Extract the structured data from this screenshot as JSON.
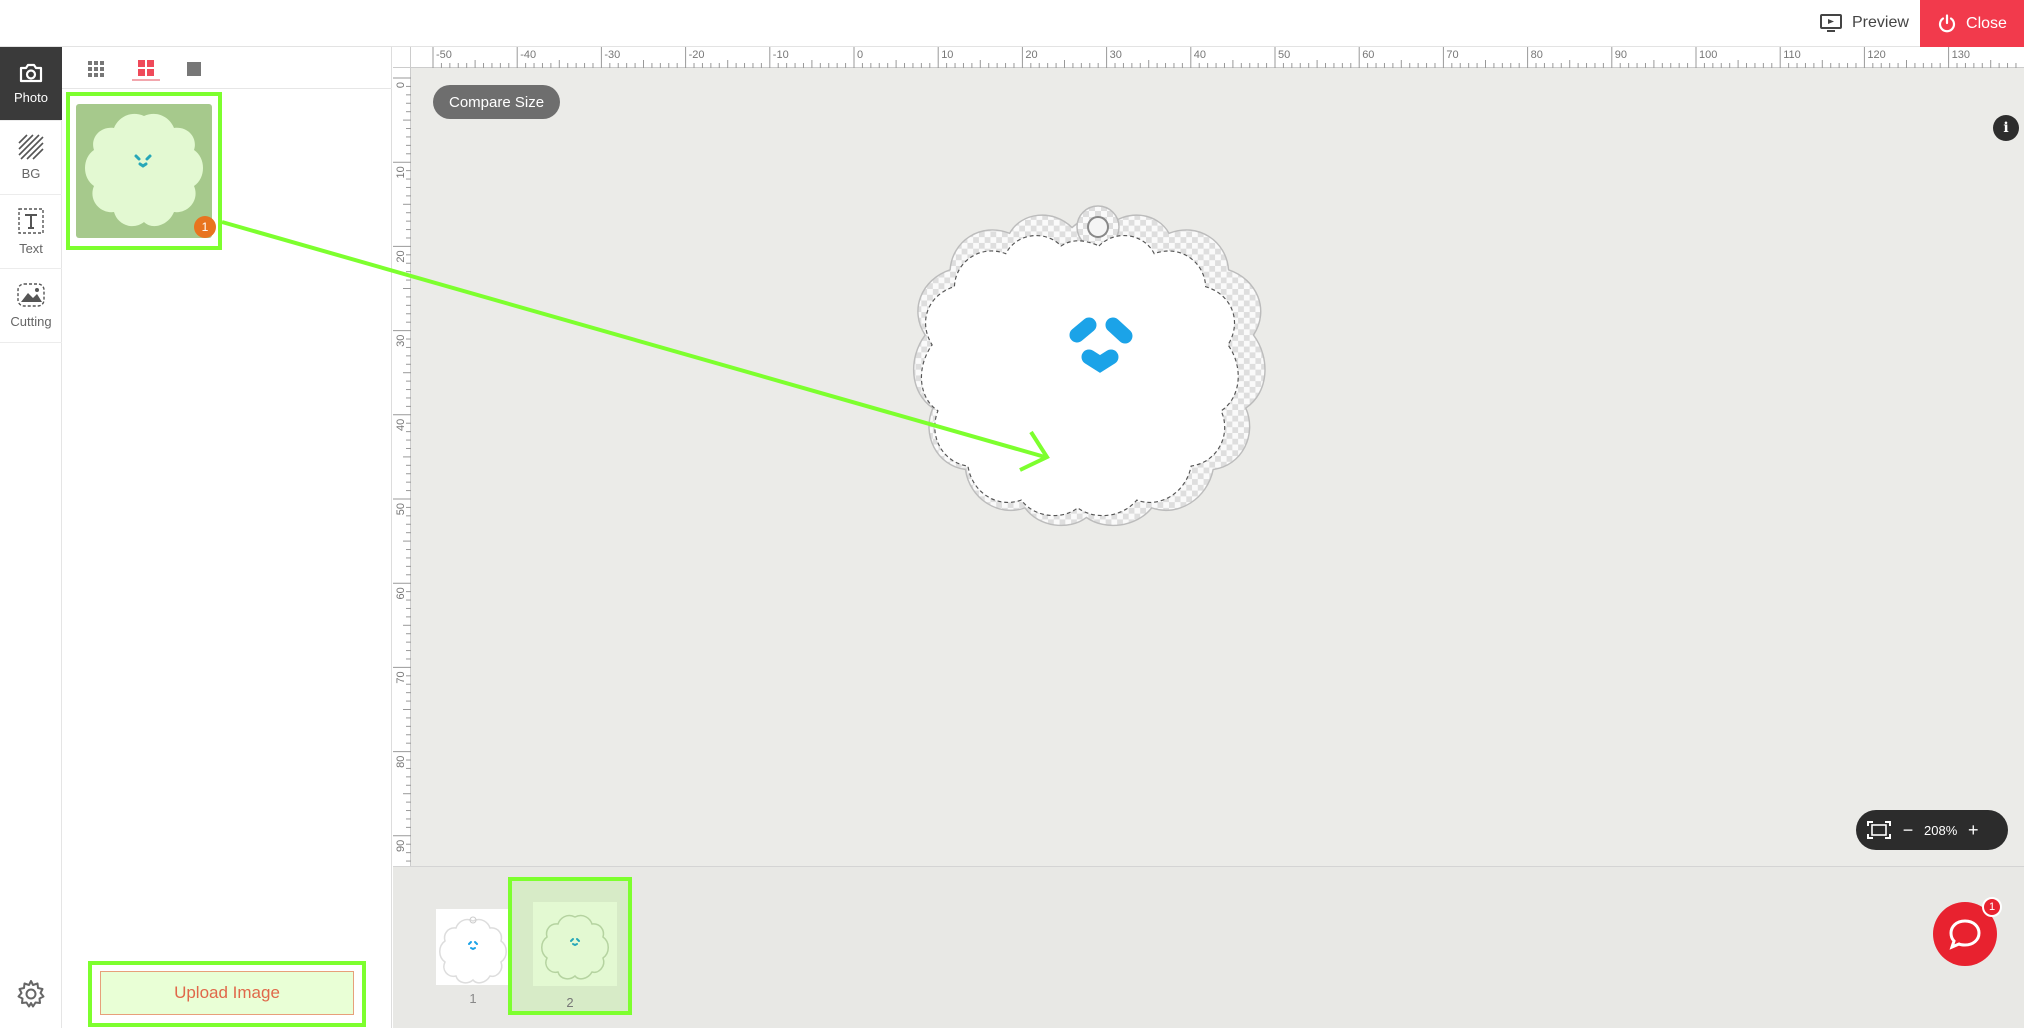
{
  "topbar": {
    "preview_label": "Preview",
    "close_label": "Close",
    "close_color": "#f23a4c"
  },
  "rail": {
    "items": [
      {
        "label": "Photo",
        "icon": "camera-icon",
        "active": true
      },
      {
        "label": "BG",
        "icon": "stripes-icon",
        "active": false
      },
      {
        "label": "Text",
        "icon": "text-icon",
        "active": false
      },
      {
        "label": "Cutting",
        "icon": "cutting-icon",
        "active": false
      }
    ],
    "settings_icon": "gear-icon"
  },
  "panel": {
    "view_modes": [
      "grid-small-icon",
      "grid-large-icon",
      "single-view-icon"
    ],
    "active_view": "grid-large-icon",
    "photo_badge": "1",
    "upload_label": "Upload Image"
  },
  "workspace": {
    "compare_label": "Compare Size",
    "info_label": "i",
    "zoom_label": "208%",
    "ruler_top_labels": [
      "-50",
      "-40",
      "-30",
      "-20",
      "-10",
      "0",
      "10",
      "20",
      "30",
      "40",
      "50",
      "60",
      "70",
      "80",
      "90",
      "100",
      "110",
      "120",
      "130"
    ],
    "ruler_left_labels": [
      "0",
      "10",
      "20",
      "30",
      "40",
      "50",
      "60",
      "70",
      "80",
      "90"
    ]
  },
  "pages": {
    "items": [
      {
        "label": "1",
        "selected": false
      },
      {
        "label": "2",
        "selected": true
      }
    ],
    "chat_badge": "1"
  },
  "colors": {
    "highlight": "#7dff2e",
    "face": "#1ba3e8",
    "accent": "#f23a4c"
  }
}
